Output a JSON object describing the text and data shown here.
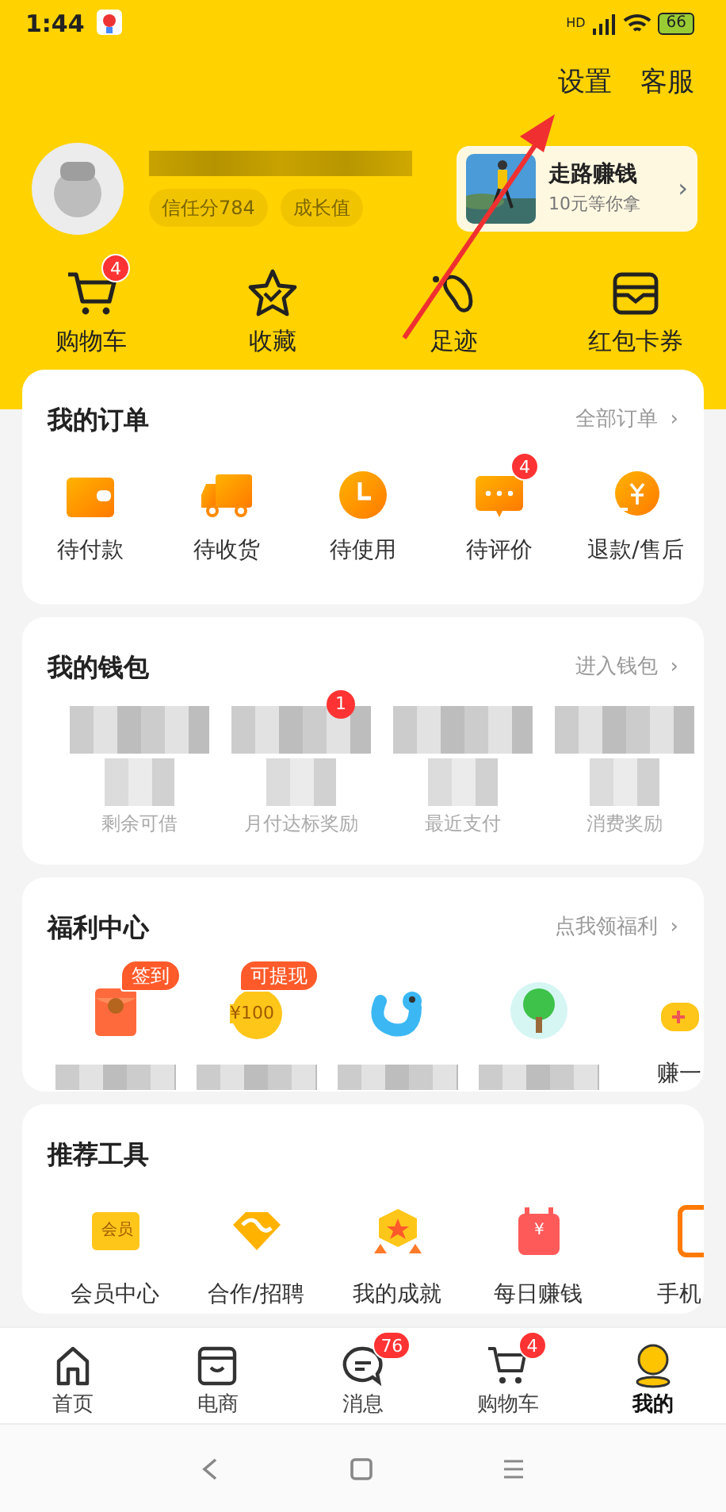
{
  "status_bar": {
    "time": "1:44",
    "network": "HD",
    "battery": "66"
  },
  "header": {
    "links": [
      "设置",
      "客服"
    ],
    "tags": [
      "信任分784",
      "成长值"
    ],
    "promo": {
      "title": "走路赚钱",
      "subtitle": "10元等你拿",
      "arrow": "›"
    }
  },
  "quick_links": [
    {
      "label": "购物车",
      "badge": "4"
    },
    {
      "label": "收藏"
    },
    {
      "label": "足迹"
    },
    {
      "label": "红包卡券"
    }
  ],
  "orders": {
    "title": "我的订单",
    "more": "全部订单",
    "more_arrow": "›",
    "items": [
      {
        "label": "待付款"
      },
      {
        "label": "待收货"
      },
      {
        "label": "待使用"
      },
      {
        "label": "待评价",
        "badge": "4"
      },
      {
        "label": "退款/售后"
      }
    ]
  },
  "wallet": {
    "title": "我的钱包",
    "more": "进入钱包",
    "more_arrow": "›",
    "items": [
      {
        "label": "剩余可借"
      },
      {
        "label": "月付达标奖励",
        "badge": "1"
      },
      {
        "label": "最近支付"
      },
      {
        "label": "消费奖励"
      }
    ]
  },
  "welfare": {
    "title": "福利中心",
    "more": "点我领福利",
    "more_arrow": "›",
    "items": [
      {
        "kind": "tagged",
        "tag": "签到"
      },
      {
        "kind": "tagged",
        "tag": "可提现",
        "icon_text": "¥100"
      },
      {
        "kind": "redacted"
      },
      {
        "kind": "redacted"
      },
      {
        "kind": "labeled",
        "label": "赚一"
      }
    ]
  },
  "tools": {
    "title": "推荐工具",
    "items": [
      {
        "label": "会员中心",
        "icon_text": "会员"
      },
      {
        "label": "合作/招聘"
      },
      {
        "label": "我的成就"
      },
      {
        "label": "每日赚钱",
        "icon_text": "¥"
      },
      {
        "label": "手机"
      }
    ]
  },
  "tab_bar": [
    {
      "label": "首页",
      "selected": false
    },
    {
      "label": "电商",
      "selected": false
    },
    {
      "label": "消息",
      "badge": "76",
      "selected": false
    },
    {
      "label": "购物车",
      "badge": "4",
      "selected": false
    },
    {
      "label": "我的",
      "selected": true
    }
  ],
  "annotation": {
    "kind": "arrow"
  }
}
